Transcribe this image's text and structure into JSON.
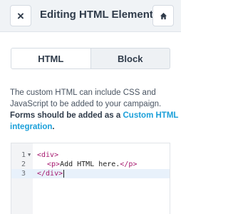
{
  "header": {
    "close_label": "×",
    "title": "Editing HTML Element",
    "home_icon": "home-icon"
  },
  "tabs": [
    {
      "label": "HTML",
      "active": true
    },
    {
      "label": "Block",
      "active": false
    }
  ],
  "description": {
    "line1": "The custom HTML can include CSS and",
    "line2": "JavaScript to be added to your campaign.",
    "bold_text": "Forms should be added as a ",
    "link_text_1": "Custom HTML",
    "link_text_2": "integration",
    "end_punct": "."
  },
  "editor": {
    "lines": [
      {
        "num": "1",
        "fold": "▼",
        "open": "<div>",
        "inner": "",
        "close": ""
      },
      {
        "num": "2",
        "fold": "",
        "open": "<p>",
        "inner": "Add HTML here.",
        "close": "</p>"
      },
      {
        "num": "3",
        "fold": "",
        "open": "</div>",
        "inner": "",
        "close": ""
      }
    ]
  },
  "colors": {
    "header_bg": "#f0f3f6",
    "link": "#1a9fd9",
    "tag": "#a6186e",
    "current_line": "#e8f1fb"
  }
}
